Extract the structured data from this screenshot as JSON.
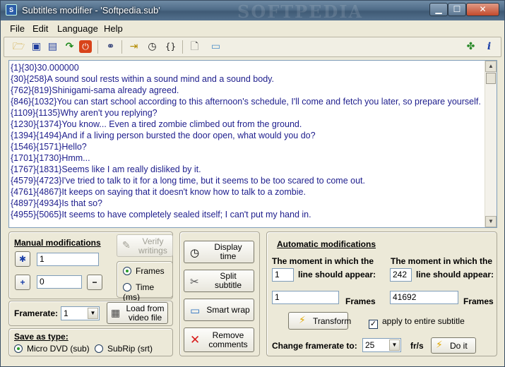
{
  "window": {
    "title": "Subtitles modifier - 'Softpedia.sub'",
    "watermark": "SOFTPEDIA",
    "controls": {
      "minimize": "▁",
      "maximize": "☐",
      "close": "✕"
    }
  },
  "menu": [
    "File",
    "Edit",
    "Language",
    "Help"
  ],
  "toolbar": {
    "icons": [
      "open-folder-icon",
      "save-icon",
      "save-as-icon",
      "redo-icon",
      "power-icon",
      "binoculars-icon",
      "insert-text-icon",
      "timer-icon",
      "braces-icon",
      "document-icon",
      "window-icon",
      "plugin-icon",
      "info-icon"
    ]
  },
  "subtitles": [
    "{1}{30}30.000000",
    "{30}{258}A sound soul rests within a sound mind and a sound body.",
    "{762}{819}Shinigami-sama already agreed.",
    "{846}{1032}You can start school according to this afternoon's schedule, I'll come and fetch you later, so prepare yourself.",
    "{1109}{1135}Why aren't you replying?",
    "{1230}{1374}You know... Even a tired zombie climbed out from the ground.",
    "{1394}{1494}And if a living person bursted the door open, what would you do?",
    "{1546}{1571}Hello?",
    "{1701}{1730}Hmm...",
    "{1767}{1831}Seems like I am really disliked by it.",
    "{4579}{4723}I've tried to talk to it for a long time, but it seems to be too scared to come out.",
    "{4761}{4867}It keeps on saying that it doesn't know how to talk to a zombie.",
    "{4897}{4934}Is that so?",
    "{4955}{5065}It seems to have completely sealed itself; I can't put my hand in."
  ],
  "manual": {
    "label": "Manual modifications",
    "field1": "1",
    "field2": "0",
    "btn_star": "✱",
    "btn_plus": "+",
    "btn_minus": "−",
    "verify": "Verify writings",
    "frames": "Frames",
    "time_ms": "Time (ms)"
  },
  "framerate": {
    "label": "Framerate:",
    "value": "1"
  },
  "load_video": "Load from video file",
  "save_type": {
    "label": "Save as type:",
    "opt1": "Micro DVD (sub)",
    "opt2": "SubRip (srt)"
  },
  "side_buttons": {
    "display_time": "Display time",
    "split": "Split subtitle",
    "smart_wrap": "Smart wrap",
    "remove_comments": "Remove comments"
  },
  "auto": {
    "label": "Automatic modifications",
    "moment_label": "The moment in which the",
    "line_label": "line should appear:",
    "left_line": "1",
    "right_line": "242",
    "left_frames": "1",
    "right_frames": "41692",
    "frames_unit": "Frames",
    "transform": "Transform",
    "apply_entire": "apply to entire subtitle",
    "change_fr_label": "Change framerate to:",
    "change_fr_value": "25",
    "fr_unit": "fr/s",
    "do_it": "Do it"
  }
}
